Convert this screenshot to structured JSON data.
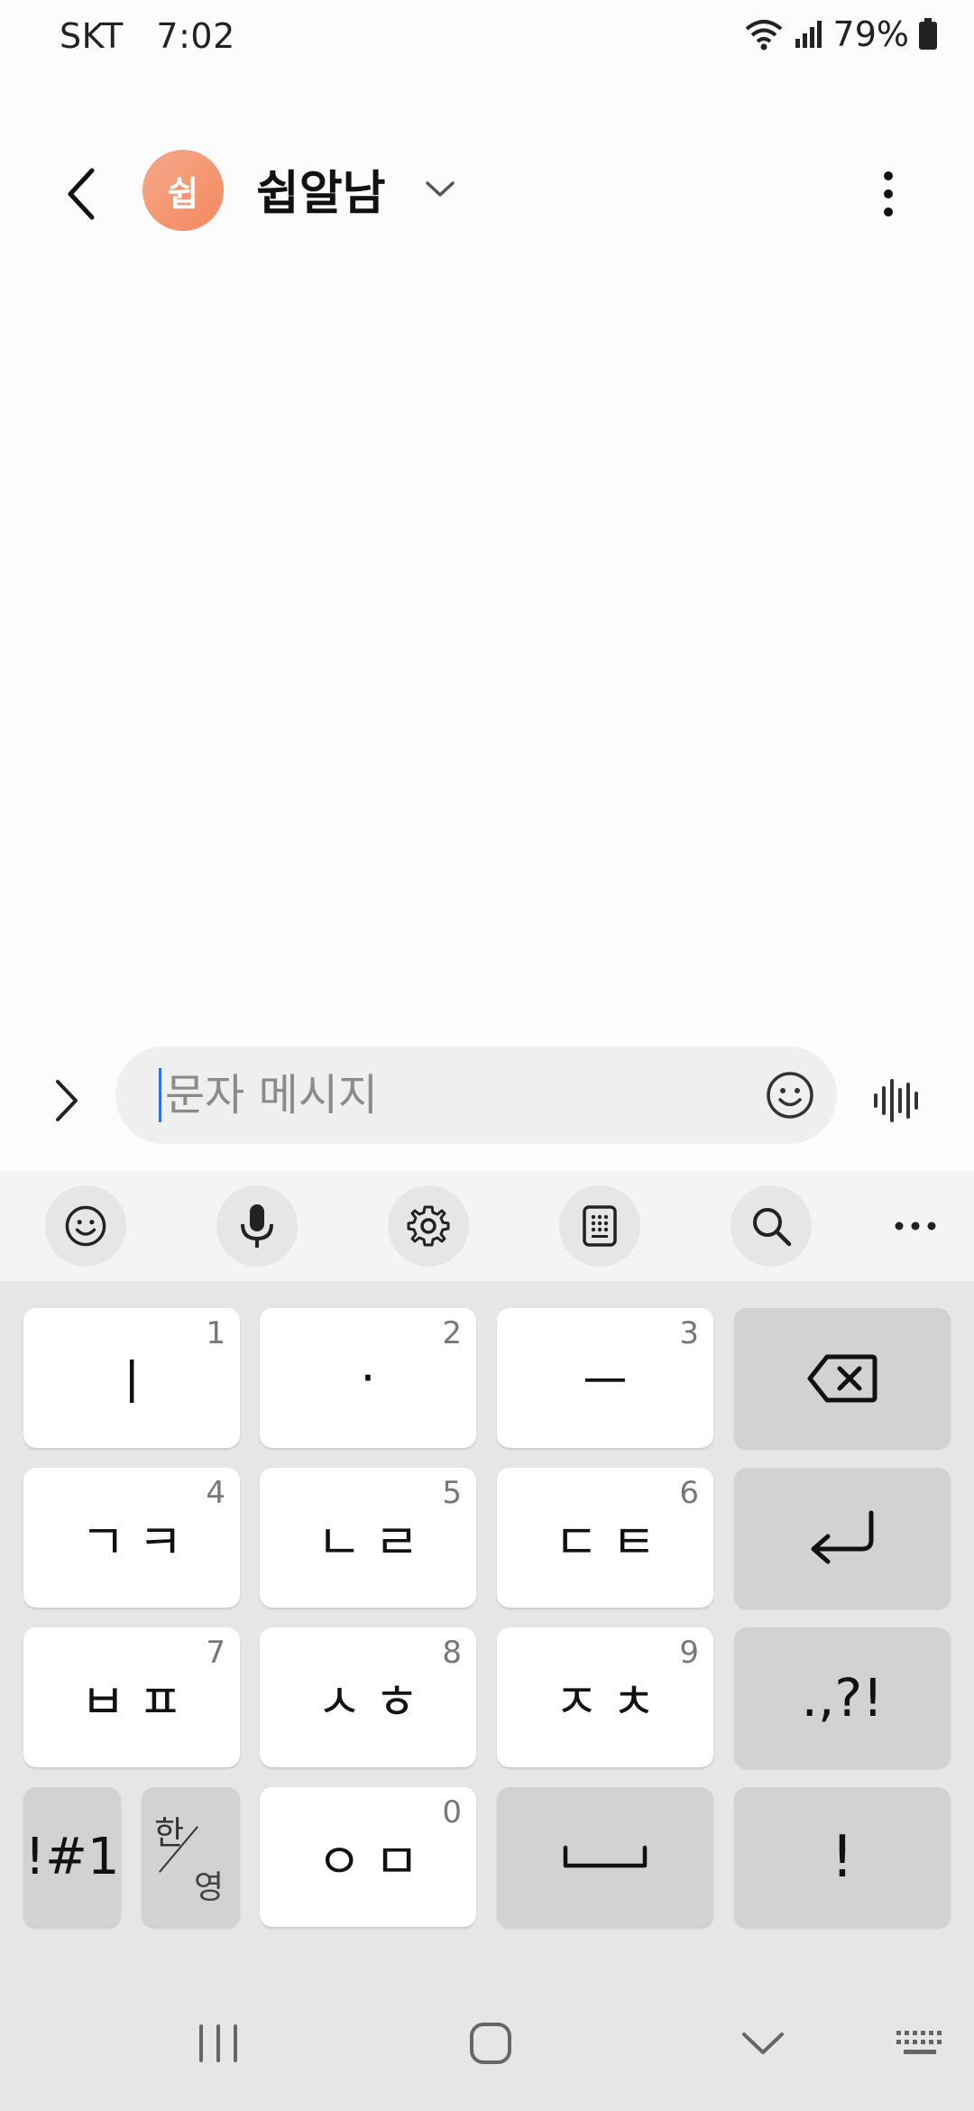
{
  "status_bar": {
    "carrier": "SKT",
    "time": "7:02",
    "battery": "79%"
  },
  "header": {
    "avatar_letter": "쉽",
    "contact_name": "쉽알남"
  },
  "compose": {
    "placeholder": "문자 메시지"
  },
  "keyboard": {
    "rows": [
      [
        {
          "label": "ㅣ",
          "num": "1"
        },
        {
          "label": "·",
          "num": "2"
        },
        {
          "label": "ㅡ",
          "num": "3"
        }
      ],
      [
        {
          "label": "ㄱㅋ",
          "num": "4"
        },
        {
          "label": "ㄴㄹ",
          "num": "5"
        },
        {
          "label": "ㄷㅌ",
          "num": "6"
        }
      ],
      [
        {
          "label": "ㅂㅍ",
          "num": "7"
        },
        {
          "label": "ㅅㅎ",
          "num": "8"
        },
        {
          "label": "ㅈㅊ",
          "num": "9"
        }
      ]
    ],
    "punct_key": ".,?!",
    "symbols_key": "!#1",
    "lang_top": "한",
    "lang_bottom": "영",
    "om_key": {
      "label": "ㅇㅁ",
      "num": "0"
    },
    "exclaim_key": "!"
  },
  "colors": {
    "accent": "#2a6de6",
    "avatar": "#f3895f",
    "keyboard_bg": "#e6e6e6"
  },
  "icons": [
    "back-arrow-icon",
    "chevron-down-icon",
    "more-vert-icon",
    "expand-icon",
    "emoji-icon",
    "voice-wave-icon",
    "mic-icon",
    "gear-icon",
    "keypad-icon",
    "search-icon",
    "backspace-icon",
    "enter-icon",
    "space-icon",
    "recents-icon",
    "home-icon",
    "hide-keyboard-icon",
    "keyboard-icon",
    "wifi-icon",
    "signal-icon",
    "battery-icon"
  ]
}
